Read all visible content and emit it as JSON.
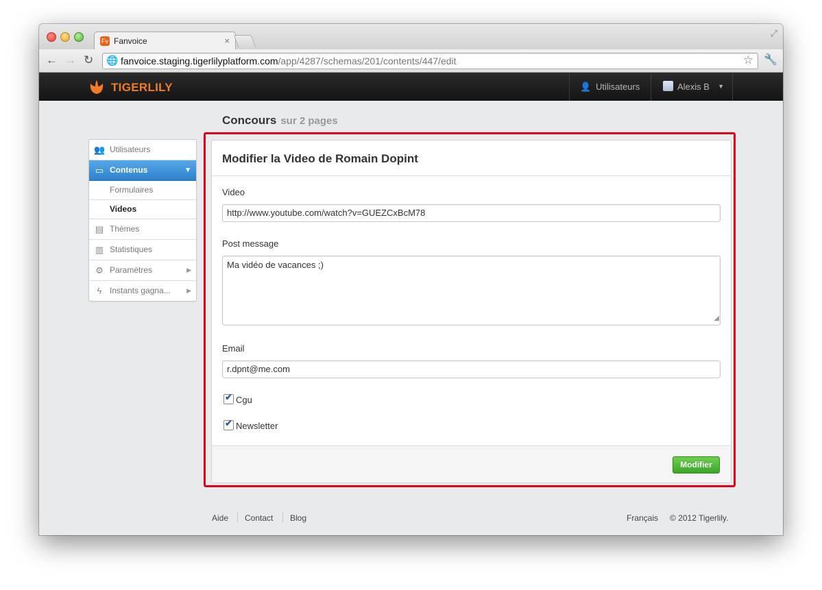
{
  "browser": {
    "tab_title": "Fanvoice",
    "tab_favicon": "Fv",
    "url_host": "fanvoice.staging.tigerlilyplatform.com",
    "url_path": "/app/4287/schemas/201/contents/447/edit"
  },
  "header": {
    "brand": "TIGERLILY",
    "nav_users": "Utilisateurs",
    "nav_account": "Alexis B"
  },
  "page": {
    "title": "Concours",
    "subtitle": "sur 2 pages"
  },
  "sidebar": {
    "items": [
      {
        "label": "Utilisateurs",
        "icon": "users-icon"
      },
      {
        "label": "Contenus",
        "icon": "comment-icon"
      },
      {
        "label": "Thèmes",
        "icon": "document-icon"
      },
      {
        "label": "Statistiques",
        "icon": "bar-chart-icon"
      },
      {
        "label": "Paramètres",
        "icon": "settings-icon"
      },
      {
        "label": "Instants gagna...",
        "icon": "lightning-icon"
      }
    ],
    "sub_items": [
      {
        "label": "Formulaires"
      },
      {
        "label": "Videos"
      }
    ]
  },
  "form": {
    "title": "Modifier la Video de Romain Dopint",
    "video_label": "Video",
    "video_value": "http://www.youtube.com/watch?v=GUEZCxBcM78",
    "post_label": "Post message",
    "post_value": "Ma vidéo de vacances ;)",
    "email_label": "Email",
    "email_value": "r.dpnt@me.com",
    "cgu_label": "Cgu",
    "cgu_checked": true,
    "newsletter_label": "Newsletter",
    "newsletter_checked": true,
    "submit_label": "Modifier"
  },
  "footer": {
    "links": [
      "Aide",
      "Contact",
      "Blog"
    ],
    "language": "Français",
    "copyright": "© 2012 Tigerlily."
  },
  "colors": {
    "brand": "#f07d26",
    "highlight": "#e2001a",
    "active_nav": "#3a8fd8",
    "submit": "#4cb836"
  }
}
